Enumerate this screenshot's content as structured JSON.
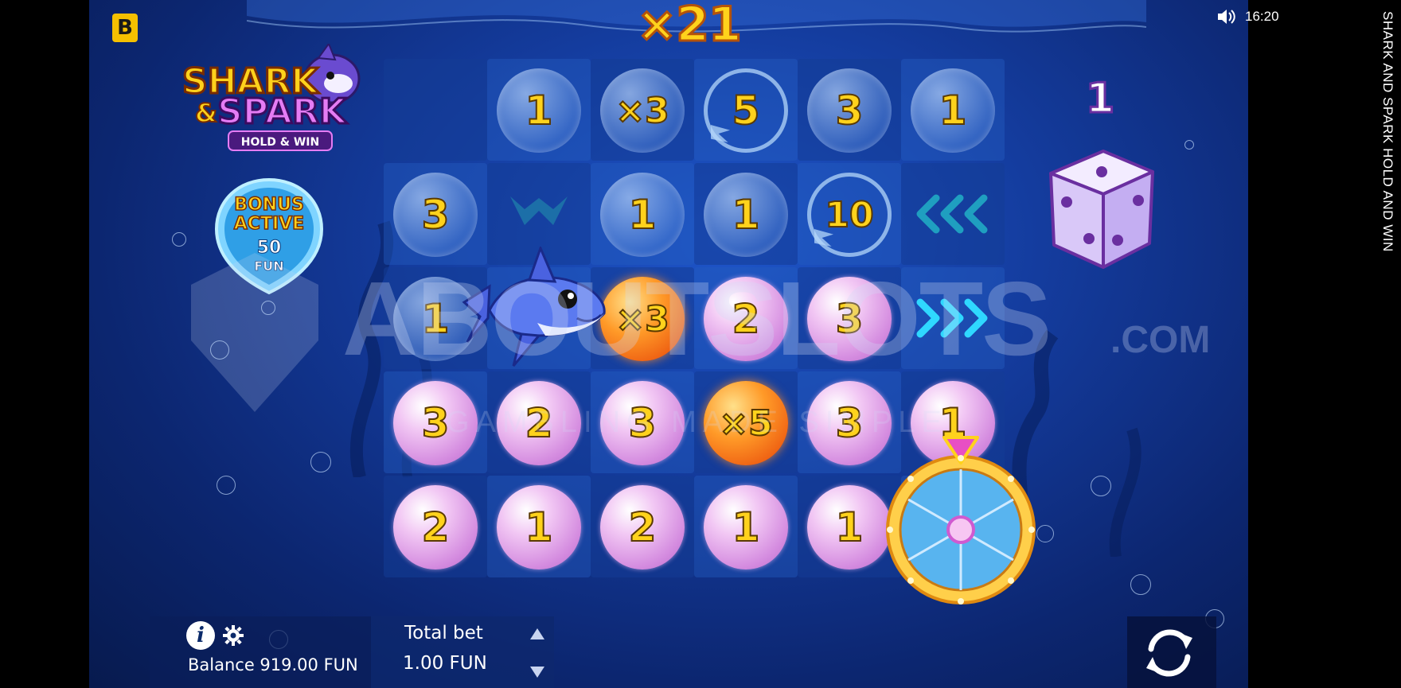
{
  "app": {
    "title": "SHARK AND SPARK HOLD AND WIN",
    "brand_letter": "B"
  },
  "status_bar": {
    "time": "16:20",
    "sound_icon": "speaker-icon"
  },
  "header": {
    "total_multiplier": "×21"
  },
  "logo": {
    "line1": "SHARK",
    "amp": "&",
    "line2": "SPARK",
    "line3": "HOLD & WIN"
  },
  "bonus": {
    "line1": "BONUS",
    "line2": "ACTIVE",
    "amount": "50",
    "currency": "FUN"
  },
  "grid": {
    "rows": [
      [
        {
          "type": "empty"
        },
        {
          "type": "clear",
          "value": "1"
        },
        {
          "type": "clear",
          "value": "×3"
        },
        {
          "type": "ring",
          "value": "5"
        },
        {
          "type": "clear",
          "value": "3"
        },
        {
          "type": "clear",
          "value": "1"
        }
      ],
      [
        {
          "type": "clear",
          "value": "3"
        },
        {
          "type": "shark-fin"
        },
        {
          "type": "clear",
          "value": "1"
        },
        {
          "type": "clear",
          "value": "1"
        },
        {
          "type": "ring",
          "value": "10"
        },
        {
          "type": "arrows-left"
        }
      ],
      [
        {
          "type": "clear",
          "value": "1"
        },
        {
          "type": "shark"
        },
        {
          "type": "orange",
          "value": "×3"
        },
        {
          "type": "pink",
          "value": "2"
        },
        {
          "type": "pink",
          "value": "3"
        },
        {
          "type": "arrows-right"
        }
      ],
      [
        {
          "type": "pink",
          "value": "3"
        },
        {
          "type": "pink",
          "value": "2"
        },
        {
          "type": "pink",
          "value": "3"
        },
        {
          "type": "orange",
          "value": "×5"
        },
        {
          "type": "pink",
          "value": "3"
        },
        {
          "type": "pink",
          "value": "1"
        }
      ],
      [
        {
          "type": "pink",
          "value": "2"
        },
        {
          "type": "pink",
          "value": "1"
        },
        {
          "type": "pink",
          "value": "2"
        },
        {
          "type": "pink",
          "value": "1"
        },
        {
          "type": "pink",
          "value": "1"
        },
        {
          "type": "wheel"
        }
      ]
    ]
  },
  "dice": {
    "count": "1",
    "face": 3
  },
  "watermark": {
    "main": "ABOUTSLOTS",
    "suffix": ".COM",
    "sub": "GAMBLING MADE SIMPLE"
  },
  "footer": {
    "balance_label": "Balance 919.00 FUN",
    "total_bet_label": "Total bet",
    "total_bet_value": "1.00 FUN",
    "info_symbol": "i"
  },
  "colors": {
    "gold": "#ffd21c",
    "pink": "#d58de0",
    "orange": "#ff9a28",
    "background": "#143c9e"
  }
}
